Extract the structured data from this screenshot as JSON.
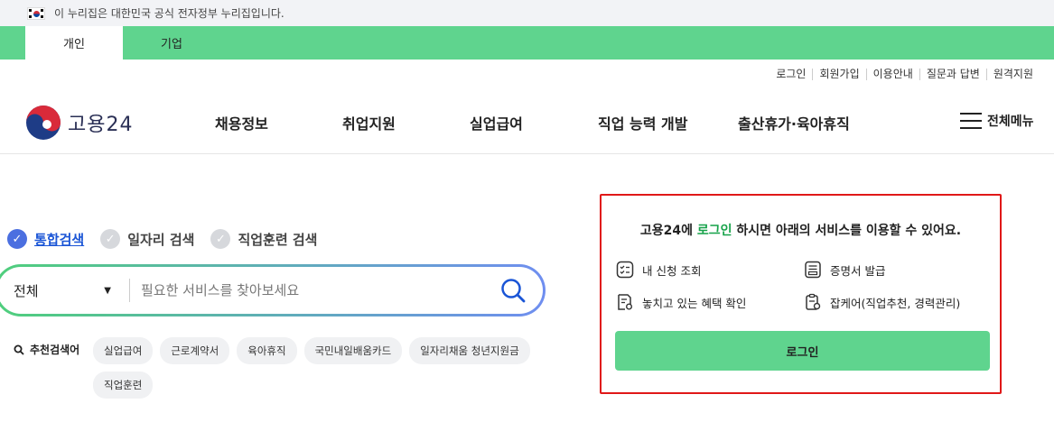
{
  "gov_banner": {
    "text": "이 누리집은 대한민국 공식 전자정부 누리집입니다."
  },
  "user_tabs": [
    {
      "label": "개인",
      "active": true
    },
    {
      "label": "기업",
      "active": false
    }
  ],
  "util_links": [
    "로그인",
    "회원가입",
    "이용안내",
    "질문과 답변",
    "원격지원"
  ],
  "logo": {
    "text": "고용24"
  },
  "gnb": [
    "채용정보",
    "취업지원",
    "실업급여",
    "직업 능력 개발",
    "출산휴가·육아휴직"
  ],
  "all_menu": "전체메뉴",
  "search": {
    "tabs": [
      {
        "label": "통합검색",
        "active": true
      },
      {
        "label": "일자리 검색",
        "active": false
      },
      {
        "label": "직업훈련 검색",
        "active": false
      }
    ],
    "scope": "전체",
    "placeholder": "필요한 서비스를 찾아보세요",
    "recommended_label": "추천검색어",
    "recommended": [
      "실업급여",
      "근로계약서",
      "육아휴직",
      "국민내일배움카드",
      "일자리채움 청년지원금",
      "직업훈련"
    ]
  },
  "login_panel": {
    "title_prefix": "고용24에 ",
    "title_link": "로그인",
    "title_suffix": " 하시면 아래의 서비스를 이용할 수 있어요.",
    "services": [
      "내 신청 조회",
      "증명서 발급",
      "놓치고 있는 혜택 확인",
      "잡케어(직업추천, 경력관리)"
    ],
    "button": "로그인"
  },
  "colors": {
    "brand_green": "#5fd48e",
    "active_blue": "#1a55d6",
    "highlight_red": "#e01818"
  }
}
